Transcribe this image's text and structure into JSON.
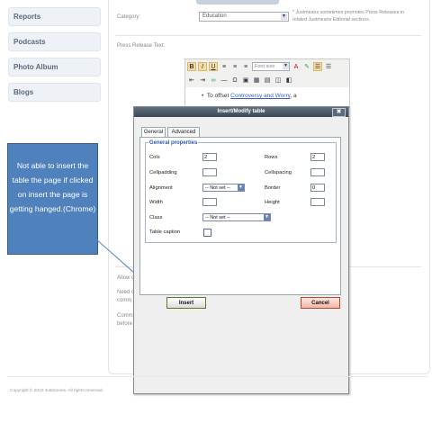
{
  "sidebar": {
    "items": [
      {
        "label": "Reports"
      },
      {
        "label": "Podcasts"
      },
      {
        "label": "Photo Album"
      },
      {
        "label": "Blogs"
      }
    ]
  },
  "form": {
    "category_label": "Category:",
    "category_value": "Education",
    "category_note_line1": "* Justmeans sometimes promotes Press Releases in",
    "category_note_line2": "related Justmeans Editorial sections.",
    "press_release_label": "Press Release Text:",
    "font_size_placeholder": "Font size",
    "editor_text_prefix": "To offset ",
    "editor_link": "Controversy and Worry",
    "editor_text_suffix": ", a",
    "allow_label": "Allow c",
    "need_label_line1": "Need c",
    "need_label_line2": "comm",
    "comm_label_line1": "Comm",
    "comm_label_line2": "before"
  },
  "callout": {
    "text": "Not able to insert the table the page if clicked on insert the page is getting hanged.(Chrome)"
  },
  "dialog": {
    "title": "Insert/Modify table",
    "close_glyph": "✖",
    "tabs": [
      "General",
      "Advanced"
    ],
    "legend": "General properties",
    "cols_label": "Cols",
    "cols_value": "2",
    "rows_label": "Rows",
    "rows_value": "2",
    "cellpadding_label": "Cellpadding",
    "cellpadding_value": "",
    "cellspacing_label": "Cellspacing",
    "cellspacing_value": "",
    "alignment_label": "Alignment",
    "alignment_value": "-- Not set --",
    "border_label": "Border",
    "border_value": "0",
    "width_label": "Width",
    "width_value": "",
    "height_label": "Height",
    "height_value": "",
    "class_label": "Class",
    "class_value": "-- Not set --",
    "caption_label": "Table caption",
    "insert_label": "Insert",
    "cancel_label": "Cancel"
  },
  "footer": {
    "copyright": "Copyright © 2010 Justmeans. All rights reserved."
  },
  "colors": {
    "callout_bg": "#4f81bd",
    "dialog_title_bg": "#4a5663",
    "legend_text": "#2e59a8",
    "insert_border": "#5a7a2a",
    "cancel_border": "#b34a3a"
  }
}
